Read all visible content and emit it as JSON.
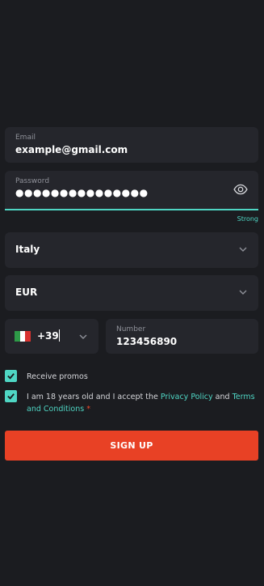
{
  "email": {
    "label": "Email",
    "value": "example@gmail.com"
  },
  "password": {
    "label": "Password",
    "value": "●●●●●●●●●●●●●●●",
    "strength": "Strong"
  },
  "country": {
    "value": "Italy"
  },
  "currency": {
    "value": "EUR"
  },
  "phone": {
    "code": "+39",
    "number_label": "Number",
    "number_value": "123456890"
  },
  "promos": {
    "label": "Receive promos"
  },
  "terms": {
    "text_prefix": "I am 18 years old and I accept the ",
    "privacy_link": "Privacy Policy",
    "and_text": " and ",
    "terms_link": "Terms and Conditions",
    "required_mark": " *"
  },
  "signup": {
    "label": "SIGN UP"
  },
  "colors": {
    "accent": "#4fd6c4",
    "primary_button": "#e84125",
    "background": "#1b1c20",
    "field": "#25262c"
  },
  "icons": {
    "password_toggle": "eye-icon",
    "dropdown": "chevron-down-icon",
    "flag": "italy-flag-icon",
    "checkbox": "checkmark-icon"
  }
}
